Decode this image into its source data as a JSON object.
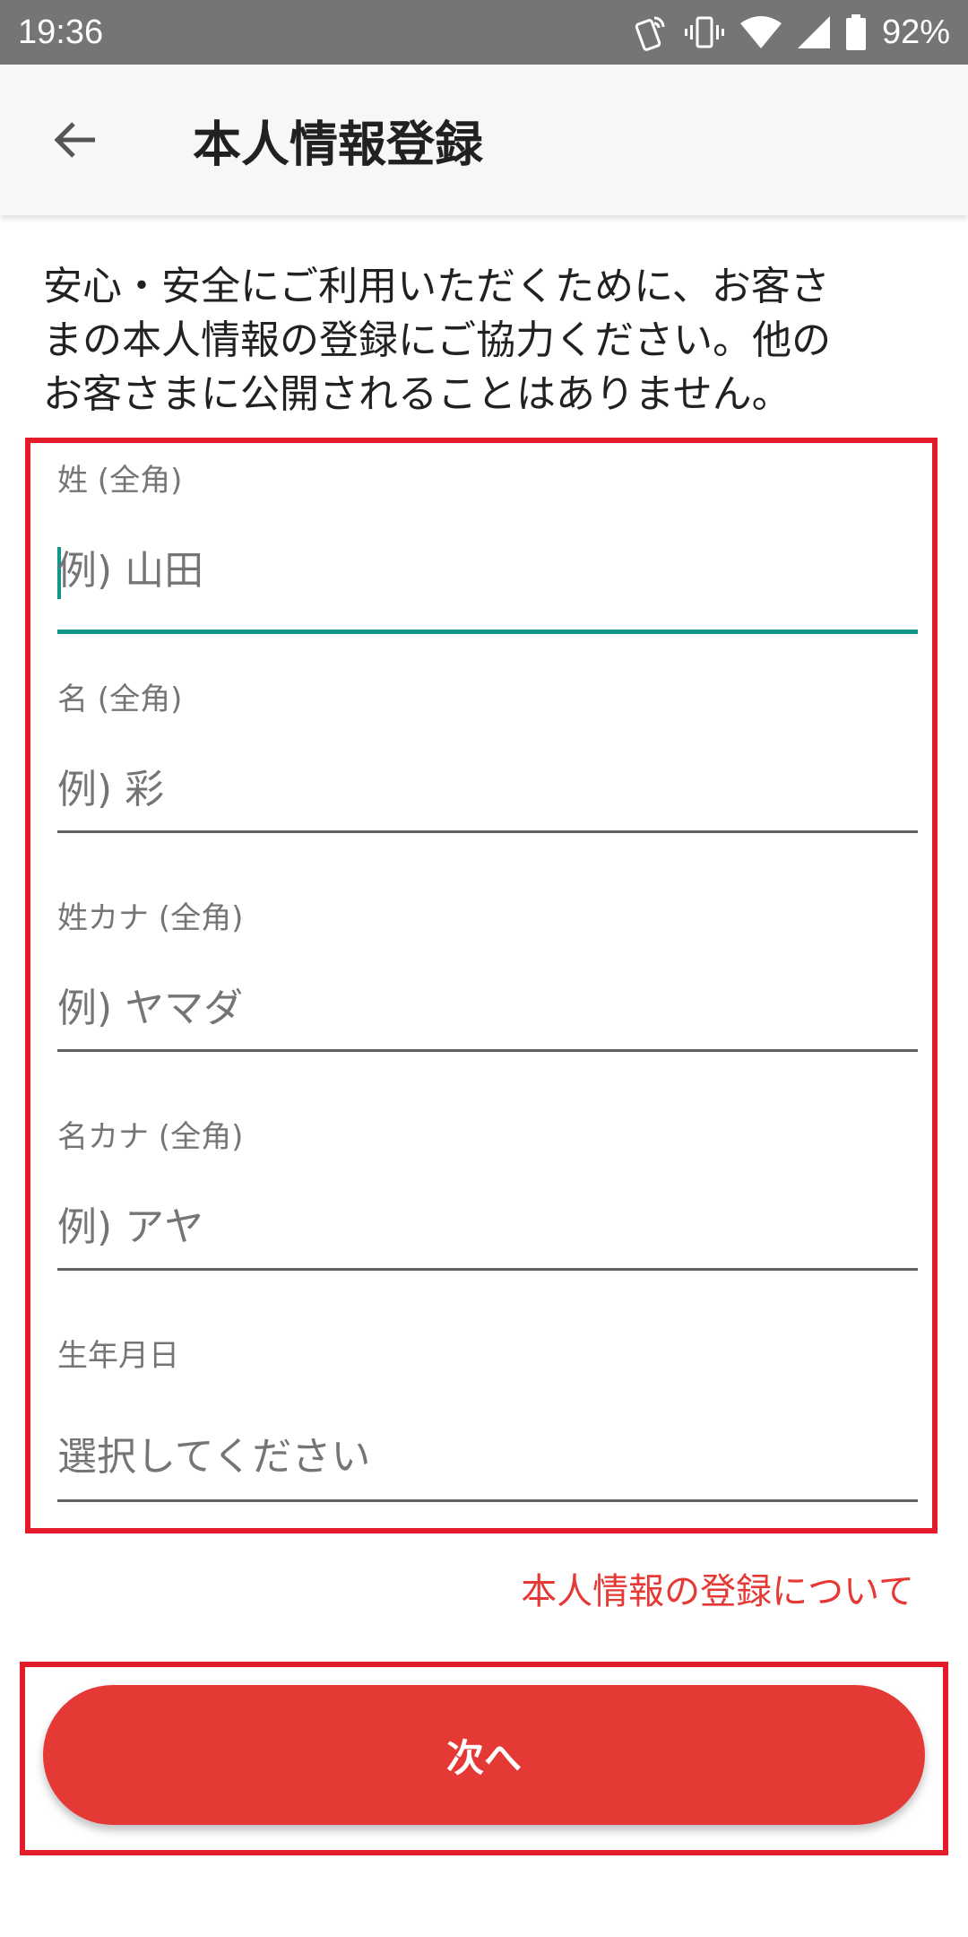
{
  "status_bar": {
    "time": "19:36",
    "battery": "92%",
    "icons": [
      "phone-icon",
      "vibrate-icon",
      "wifi-icon",
      "signal-icon",
      "battery-icon"
    ]
  },
  "app_bar": {
    "title": "本人情報登録",
    "back_icon": "back-arrow-icon"
  },
  "intro": {
    "line1": "安心・安全にご利用いただくために、お客さ",
    "line2": "まの本人情報の登録にご協力ください。他の",
    "line3": "お客さまに公開されることはありません。"
  },
  "form": {
    "last_name": {
      "label": "姓 (全角)",
      "placeholder": "例) 山田"
    },
    "first_name": {
      "label": "名 (全角)",
      "placeholder": "例) 彩"
    },
    "last_name_kana": {
      "label": "姓カナ (全角)",
      "placeholder": "例) ヤマダ"
    },
    "first_name_kana": {
      "label": "名カナ (全角)",
      "placeholder": "例) アヤ"
    },
    "birthdate": {
      "label": "生年月日",
      "placeholder": "選択してください"
    }
  },
  "about_link": "本人情報の登録について",
  "next_button": "次へ",
  "colors": {
    "accent_red": "#e53935",
    "highlight_red": "#e21c2a",
    "focus_teal": "#13968a",
    "status_bar": "#757575"
  }
}
